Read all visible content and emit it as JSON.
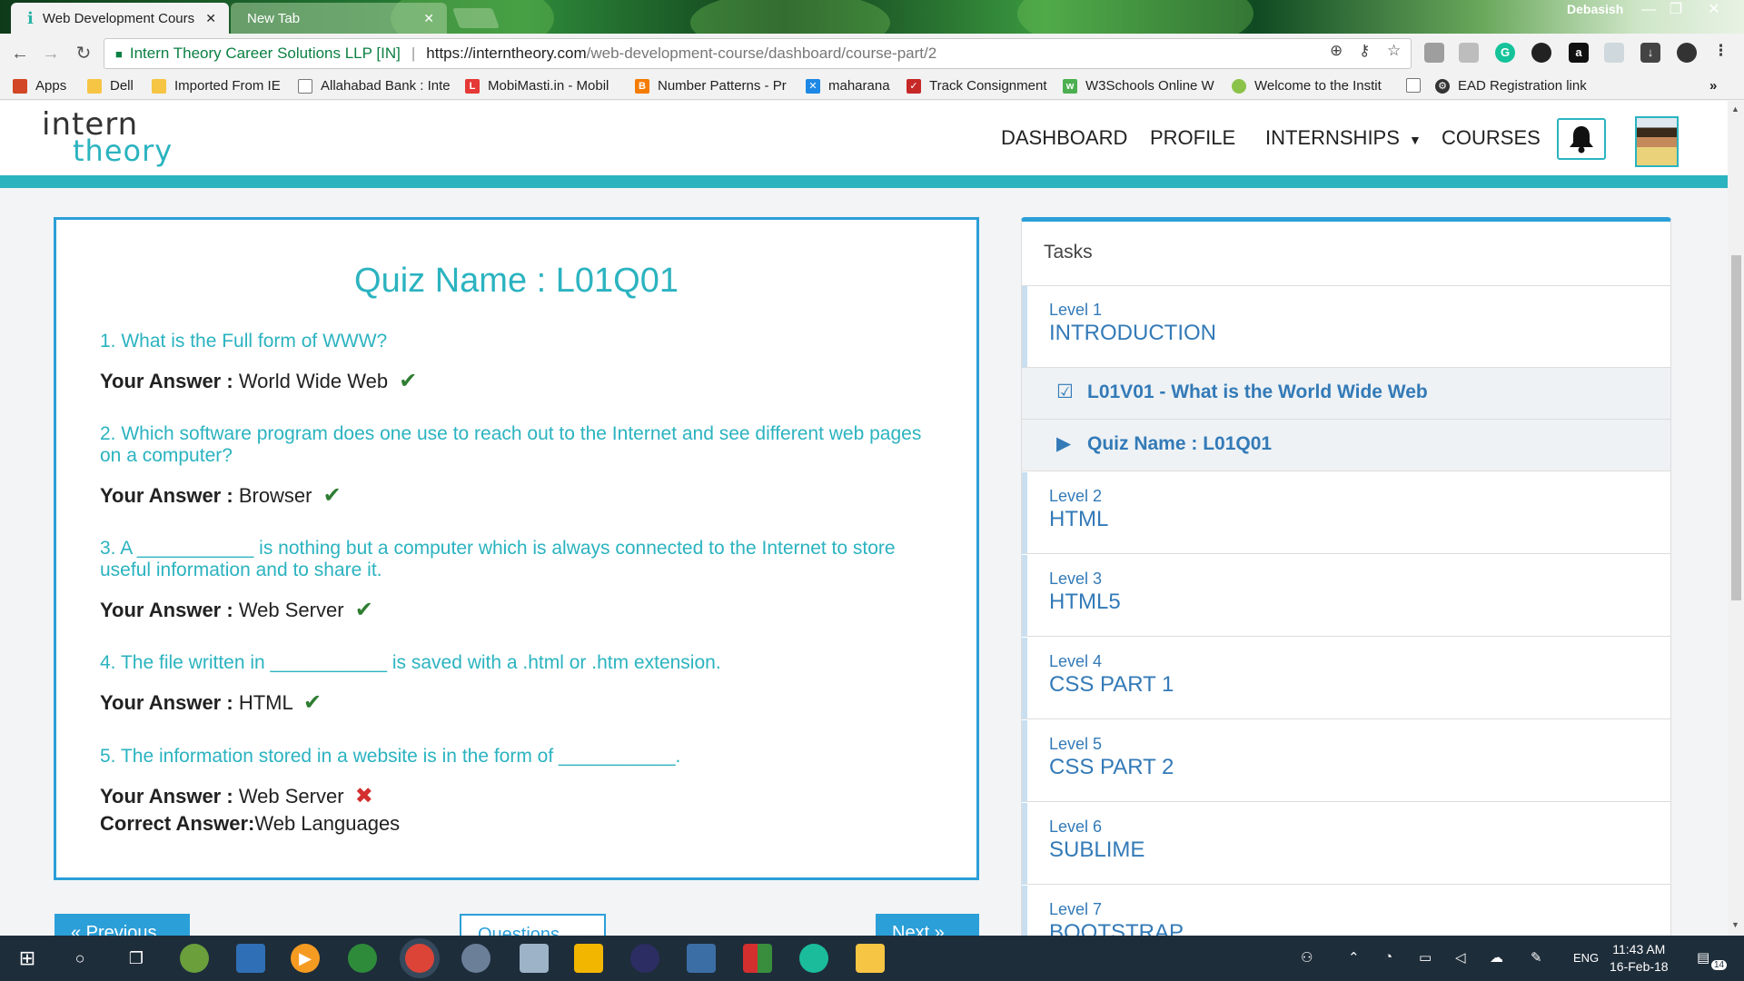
{
  "browser": {
    "tabs": [
      {
        "title": "Web Development Cours",
        "favicon": "i",
        "active": true
      },
      {
        "title": "New Tab",
        "active": false
      }
    ],
    "profile_name": "Debasish",
    "site_identity": "Intern Theory Career Solutions LLP [IN]",
    "url_host": "https://interntheory.com",
    "url_path": "/web-development-course/dashboard/course-part/2"
  },
  "bookmarks": [
    {
      "label": "Apps",
      "icon": "apps-grid-icon",
      "color": "#d24726"
    },
    {
      "label": "Dell",
      "icon": "folder-icon",
      "color": "#f6c544"
    },
    {
      "label": "Imported From IE",
      "icon": "folder-icon",
      "color": "#f6c544"
    },
    {
      "label": "Allahabad Bank : Inte",
      "icon": "page-icon",
      "color": "#ffffff"
    },
    {
      "label": "MobiMasti.in - Mobil",
      "icon": "mobimasti-icon",
      "color": "#e53935"
    },
    {
      "label": "Number Patterns - Pr",
      "icon": "blogger-icon",
      "color": "#f57c00"
    },
    {
      "label": "maharana",
      "icon": "x-icon",
      "color": "#1e88e5"
    },
    {
      "label": "Track Consignment",
      "icon": "check-icon",
      "color": "#c62828"
    },
    {
      "label": "W3Schools Online W",
      "icon": "w3-icon",
      "color": "#4caf50"
    },
    {
      "label": "Welcome to the Instit",
      "icon": "badge-icon",
      "color": "#8bc34a"
    },
    {
      "label": "EAD Registration link",
      "icon": "gear-icon",
      "color": "#333333"
    }
  ],
  "site": {
    "logo_top": "intern",
    "logo_bottom": "theory",
    "nav": [
      "DASHBOARD",
      "PROFILE",
      "INTERNSHIPS",
      "COURSES"
    ]
  },
  "quiz": {
    "title": "Quiz Name : L01Q01",
    "answer_label": "Your Answer :",
    "correct_label": "Correct Answer:",
    "questions": [
      {
        "q": "1. What is the Full form of WWW?",
        "answer": "World Wide Web",
        "correct": true
      },
      {
        "q": "2. Which software program does one use to reach out to the Internet and see different web pages on a computer?",
        "answer": "Browser",
        "correct": true
      },
      {
        "q": "3. A ___________ is nothing but a computer which is always connected to the Internet to store useful information and to share it.",
        "answer": "Web Server",
        "correct": true
      },
      {
        "q": "4. The file written in ___________ is saved with a .html or .htm extension.",
        "answer": "HTML",
        "correct": true
      },
      {
        "q": "5. The information stored in a website is in the form of ___________.",
        "answer": "Web Server",
        "correct": false,
        "correct_answer": "Web Languages"
      }
    ],
    "buttons": {
      "previous": "« Previous",
      "questions": "Questions",
      "next": "Next »"
    }
  },
  "tasks": {
    "header": "Tasks",
    "levels": [
      {
        "num": "Level 1",
        "name": "INTRODUCTION"
      },
      {
        "num": "Level 2",
        "name": "HTML"
      },
      {
        "num": "Level 3",
        "name": "HTML5"
      },
      {
        "num": "Level 4",
        "name": "CSS PART 1"
      },
      {
        "num": "Level 5",
        "name": "CSS PART 2"
      },
      {
        "num": "Level 6",
        "name": "SUBLIME"
      },
      {
        "num": "Level 7",
        "name": "BOOTSTRAP"
      }
    ],
    "lessons": [
      {
        "label": "L01V01 - What is the World Wide Web",
        "icon": "checkbox-icon"
      },
      {
        "label": "Quiz Name : L01Q01",
        "icon": "play-circle-icon"
      }
    ]
  },
  "taskbar": {
    "time": "11:43 AM",
    "date": "16-Feb-18",
    "lang": "ENG",
    "notifications": "14"
  },
  "colors": {
    "accent_teal": "#2bb3c0",
    "panel_border_blue": "#2b9fd8",
    "link_blue": "#337ab7",
    "correct_green": "#2e7d32",
    "wrong_red": "#d32f2f"
  }
}
